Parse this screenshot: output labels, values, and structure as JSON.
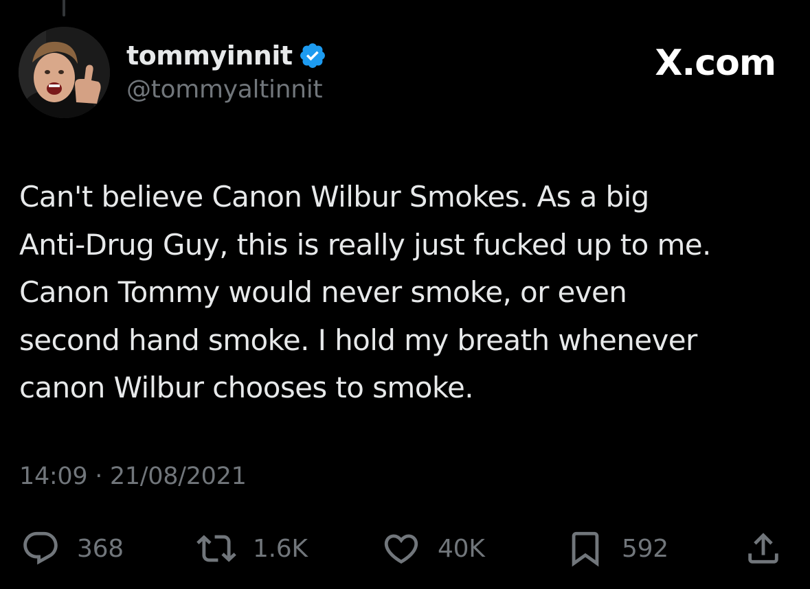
{
  "colors": {
    "background": "#000000",
    "text_primary": "#e7e9ea",
    "text_secondary": "#71767b",
    "verified_badge": "#1d9bf0"
  },
  "author": {
    "display_name": "tommyinnit",
    "handle": "@tommyaltinnit",
    "verified": true,
    "avatar_icon": "user-avatar-photo"
  },
  "brand": {
    "label": "X.com"
  },
  "tweet": {
    "lines": [
      "Can't believe Canon Wilbur Smokes. As a big",
      "Anti-Drug Guy, this is really just fucked up to me.",
      "Canon Tommy would never smoke, or even",
      "second hand smoke. I hold my breath whenever",
      "canon Wilbur chooses to smoke."
    ],
    "timestamp": "14:09 · 21/08/2021"
  },
  "actions": {
    "reply": {
      "icon": "reply-icon",
      "count": "368"
    },
    "repost": {
      "icon": "repost-icon",
      "count": "1.6K"
    },
    "like": {
      "icon": "heart-icon",
      "count": "40K"
    },
    "bookmark": {
      "icon": "bookmark-icon",
      "count": "592"
    },
    "share": {
      "icon": "share-icon"
    }
  }
}
